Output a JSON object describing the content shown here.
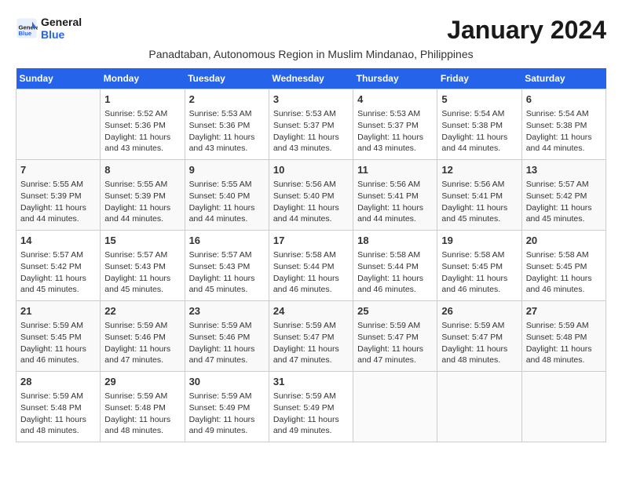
{
  "header": {
    "logo_line1": "General",
    "logo_line2": "Blue",
    "month_title": "January 2024",
    "location": "Panadtaban, Autonomous Region in Muslim Mindanao, Philippines"
  },
  "days_of_week": [
    "Sunday",
    "Monday",
    "Tuesday",
    "Wednesday",
    "Thursday",
    "Friday",
    "Saturday"
  ],
  "weeks": [
    [
      {
        "day": "",
        "empty": true
      },
      {
        "day": "1",
        "sunrise": "5:52 AM",
        "sunset": "5:36 PM",
        "daylight": "11 hours and 43 minutes."
      },
      {
        "day": "2",
        "sunrise": "5:53 AM",
        "sunset": "5:36 PM",
        "daylight": "11 hours and 43 minutes."
      },
      {
        "day": "3",
        "sunrise": "5:53 AM",
        "sunset": "5:37 PM",
        "daylight": "11 hours and 43 minutes."
      },
      {
        "day": "4",
        "sunrise": "5:53 AM",
        "sunset": "5:37 PM",
        "daylight": "11 hours and 43 minutes."
      },
      {
        "day": "5",
        "sunrise": "5:54 AM",
        "sunset": "5:38 PM",
        "daylight": "11 hours and 44 minutes."
      },
      {
        "day": "6",
        "sunrise": "5:54 AM",
        "sunset": "5:38 PM",
        "daylight": "11 hours and 44 minutes."
      }
    ],
    [
      {
        "day": "7",
        "sunrise": "5:55 AM",
        "sunset": "5:39 PM",
        "daylight": "11 hours and 44 minutes."
      },
      {
        "day": "8",
        "sunrise": "5:55 AM",
        "sunset": "5:39 PM",
        "daylight": "11 hours and 44 minutes."
      },
      {
        "day": "9",
        "sunrise": "5:55 AM",
        "sunset": "5:40 PM",
        "daylight": "11 hours and 44 minutes."
      },
      {
        "day": "10",
        "sunrise": "5:56 AM",
        "sunset": "5:40 PM",
        "daylight": "11 hours and 44 minutes."
      },
      {
        "day": "11",
        "sunrise": "5:56 AM",
        "sunset": "5:41 PM",
        "daylight": "11 hours and 44 minutes."
      },
      {
        "day": "12",
        "sunrise": "5:56 AM",
        "sunset": "5:41 PM",
        "daylight": "11 hours and 45 minutes."
      },
      {
        "day": "13",
        "sunrise": "5:57 AM",
        "sunset": "5:42 PM",
        "daylight": "11 hours and 45 minutes."
      }
    ],
    [
      {
        "day": "14",
        "sunrise": "5:57 AM",
        "sunset": "5:42 PM",
        "daylight": "11 hours and 45 minutes."
      },
      {
        "day": "15",
        "sunrise": "5:57 AM",
        "sunset": "5:43 PM",
        "daylight": "11 hours and 45 minutes."
      },
      {
        "day": "16",
        "sunrise": "5:57 AM",
        "sunset": "5:43 PM",
        "daylight": "11 hours and 45 minutes."
      },
      {
        "day": "17",
        "sunrise": "5:58 AM",
        "sunset": "5:44 PM",
        "daylight": "11 hours and 46 minutes."
      },
      {
        "day": "18",
        "sunrise": "5:58 AM",
        "sunset": "5:44 PM",
        "daylight": "11 hours and 46 minutes."
      },
      {
        "day": "19",
        "sunrise": "5:58 AM",
        "sunset": "5:45 PM",
        "daylight": "11 hours and 46 minutes."
      },
      {
        "day": "20",
        "sunrise": "5:58 AM",
        "sunset": "5:45 PM",
        "daylight": "11 hours and 46 minutes."
      }
    ],
    [
      {
        "day": "21",
        "sunrise": "5:59 AM",
        "sunset": "5:45 PM",
        "daylight": "11 hours and 46 minutes."
      },
      {
        "day": "22",
        "sunrise": "5:59 AM",
        "sunset": "5:46 PM",
        "daylight": "11 hours and 47 minutes."
      },
      {
        "day": "23",
        "sunrise": "5:59 AM",
        "sunset": "5:46 PM",
        "daylight": "11 hours and 47 minutes."
      },
      {
        "day": "24",
        "sunrise": "5:59 AM",
        "sunset": "5:47 PM",
        "daylight": "11 hours and 47 minutes."
      },
      {
        "day": "25",
        "sunrise": "5:59 AM",
        "sunset": "5:47 PM",
        "daylight": "11 hours and 47 minutes."
      },
      {
        "day": "26",
        "sunrise": "5:59 AM",
        "sunset": "5:47 PM",
        "daylight": "11 hours and 48 minutes."
      },
      {
        "day": "27",
        "sunrise": "5:59 AM",
        "sunset": "5:48 PM",
        "daylight": "11 hours and 48 minutes."
      }
    ],
    [
      {
        "day": "28",
        "sunrise": "5:59 AM",
        "sunset": "5:48 PM",
        "daylight": "11 hours and 48 minutes."
      },
      {
        "day": "29",
        "sunrise": "5:59 AM",
        "sunset": "5:48 PM",
        "daylight": "11 hours and 48 minutes."
      },
      {
        "day": "30",
        "sunrise": "5:59 AM",
        "sunset": "5:49 PM",
        "daylight": "11 hours and 49 minutes."
      },
      {
        "day": "31",
        "sunrise": "5:59 AM",
        "sunset": "5:49 PM",
        "daylight": "11 hours and 49 minutes."
      },
      {
        "day": "",
        "empty": true
      },
      {
        "day": "",
        "empty": true
      },
      {
        "day": "",
        "empty": true
      }
    ]
  ]
}
